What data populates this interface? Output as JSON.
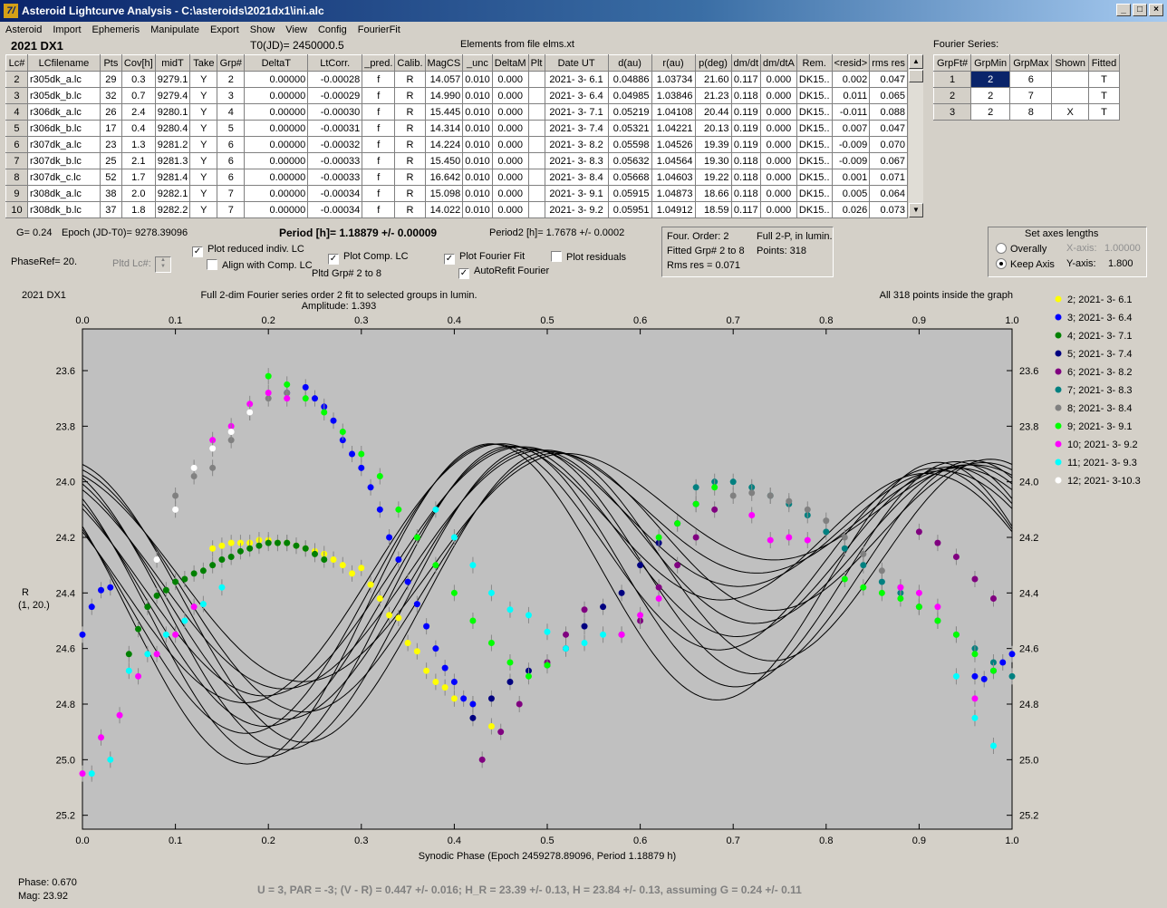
{
  "window": {
    "title": "Asteroid Lightcurve Analysis - C:\\asteroids\\2021dx1\\ini.alc",
    "icon_glyph": "7/"
  },
  "menu": [
    "Asteroid",
    "Import",
    "Ephemeris",
    "Manipulate",
    "Export",
    "Show",
    "View",
    "Config",
    "FourierFit"
  ],
  "header": {
    "object": "2021 DX1",
    "t0": "T0(JD)= 2450000.5",
    "elements": "Elements from file elms.xt"
  },
  "lc_table": {
    "columns": [
      "Lc#",
      "LCfilename",
      "Pts",
      "Cov[h]",
      "midT",
      "Take",
      "Grp#",
      "DeltaT",
      "LtCorr.",
      "_pred.",
      "Calib.",
      "MagCS",
      "_unc",
      "DeltaM",
      "Plt",
      "Date UT",
      "d(au)",
      "r(au)",
      "p(deg)",
      "dm/dt",
      "dm/dtA",
      "Rem.",
      "<resid>",
      "rms res"
    ],
    "rows": [
      [
        "2",
        "r305dk_a.lc",
        "29",
        "0.3",
        "9279.1",
        "Y",
        "2",
        "0.00000",
        "-0.00028",
        "f",
        "R",
        "14.057",
        "0.010",
        "0.000",
        "",
        "2021- 3- 6.1",
        "0.04886",
        "1.03734",
        "21.60",
        "0.117",
        "0.000",
        "DK15..",
        "0.002",
        "0.047"
      ],
      [
        "3",
        "r305dk_b.lc",
        "32",
        "0.7",
        "9279.4",
        "Y",
        "3",
        "0.00000",
        "-0.00029",
        "f",
        "R",
        "14.990",
        "0.010",
        "0.000",
        "",
        "2021- 3- 6.4",
        "0.04985",
        "1.03846",
        "21.23",
        "0.118",
        "0.000",
        "DK15..",
        "0.011",
        "0.065"
      ],
      [
        "4",
        "r306dk_a.lc",
        "26",
        "2.4",
        "9280.1",
        "Y",
        "4",
        "0.00000",
        "-0.00030",
        "f",
        "R",
        "15.445",
        "0.010",
        "0.000",
        "",
        "2021- 3- 7.1",
        "0.05219",
        "1.04108",
        "20.44",
        "0.119",
        "0.000",
        "DK15..",
        "-0.011",
        "0.088"
      ],
      [
        "5",
        "r306dk_b.lc",
        "17",
        "0.4",
        "9280.4",
        "Y",
        "5",
        "0.00000",
        "-0.00031",
        "f",
        "R",
        "14.314",
        "0.010",
        "0.000",
        "",
        "2021- 3- 7.4",
        "0.05321",
        "1.04221",
        "20.13",
        "0.119",
        "0.000",
        "DK15..",
        "0.007",
        "0.047"
      ],
      [
        "6",
        "r307dk_a.lc",
        "23",
        "1.3",
        "9281.2",
        "Y",
        "6",
        "0.00000",
        "-0.00032",
        "f",
        "R",
        "14.224",
        "0.010",
        "0.000",
        "",
        "2021- 3- 8.2",
        "0.05598",
        "1.04526",
        "19.39",
        "0.119",
        "0.000",
        "DK15..",
        "-0.009",
        "0.070"
      ],
      [
        "7",
        "r307dk_b.lc",
        "25",
        "2.1",
        "9281.3",
        "Y",
        "6",
        "0.00000",
        "-0.00033",
        "f",
        "R",
        "15.450",
        "0.010",
        "0.000",
        "",
        "2021- 3- 8.3",
        "0.05632",
        "1.04564",
        "19.30",
        "0.118",
        "0.000",
        "DK15..",
        "-0.009",
        "0.067"
      ],
      [
        "8",
        "r307dk_c.lc",
        "52",
        "1.7",
        "9281.4",
        "Y",
        "6",
        "0.00000",
        "-0.00033",
        "f",
        "R",
        "16.642",
        "0.010",
        "0.000",
        "",
        "2021- 3- 8.4",
        "0.05668",
        "1.04603",
        "19.22",
        "0.118",
        "0.000",
        "DK15..",
        "0.001",
        "0.071"
      ],
      [
        "9",
        "r308dk_a.lc",
        "38",
        "2.0",
        "9282.1",
        "Y",
        "7",
        "0.00000",
        "-0.00034",
        "f",
        "R",
        "15.098",
        "0.010",
        "0.000",
        "",
        "2021- 3- 9.1",
        "0.05915",
        "1.04873",
        "18.66",
        "0.118",
        "0.000",
        "DK15..",
        "0.005",
        "0.064"
      ],
      [
        "10",
        "r308dk_b.lc",
        "37",
        "1.8",
        "9282.2",
        "Y",
        "7",
        "0.00000",
        "-0.00034",
        "f",
        "R",
        "14.022",
        "0.010",
        "0.000",
        "",
        "2021- 3- 9.2",
        "0.05951",
        "1.04912",
        "18.59",
        "0.117",
        "0.000",
        "DK15..",
        "0.026",
        "0.073"
      ]
    ]
  },
  "fourier_series": {
    "title": "Fourier Series:",
    "columns": [
      "GrpFt#",
      "GrpMin",
      "GrpMax",
      "Shown",
      "Fitted"
    ],
    "rows": [
      [
        "1",
        "2",
        "6",
        "",
        "T"
      ],
      [
        "2",
        "2",
        "7",
        "",
        "T"
      ],
      [
        "3",
        "2",
        "8",
        "X",
        "T"
      ]
    ]
  },
  "info": {
    "g": "G= 0.24",
    "epoch": "Epoch (JD-T0)= 9278.39096",
    "period": "Period [h]= 1.18879 +/- 0.00009",
    "period2": "Period2 [h]= 1.7678 +/- 0.0002",
    "phaseref": "PhaseRef= 20.",
    "pltd_lc": "Pltd Lc#:",
    "plot_reduced": "Plot reduced indiv. LC",
    "align": "Align with Comp. LC",
    "plot_comp": "Plot Comp. LC",
    "pltd_grp": "Pltd Grp#  2   to   8",
    "plot_fourier": "Plot Fourier Fit",
    "autorefit": "AutoRefit Fourier",
    "plot_residuals": "Plot residuals"
  },
  "fit_summary": {
    "four_order": "Four. Order:  2",
    "full2p": "Full 2-P, in lumin.",
    "fitted_grp": "Fitted Grp# 2 to 8",
    "points": "Points: 318",
    "rms": "Rms res     = 0.071"
  },
  "axes_panel": {
    "title": "Set axes lengths",
    "overally": "Overally",
    "keep_axis": "Keep Axis",
    "x_axis_label": "X-axis:",
    "x_axis_value": "1.00000",
    "y_axis_label": "Y-axis:",
    "y_axis_value": "1.800"
  },
  "chart_data": {
    "type": "scatter",
    "title": "Full 2-dim Fourier series order 2 fit to selected groups in lumin.",
    "subtitle": "Amplitude: 1.393",
    "object_label": "2021 DX1",
    "top_right_note": "All 318 points inside the graph",
    "xlabel": "Synodic Phase (Epoch 2459278.89096, Period 1.18879 h)",
    "ylabel": "R",
    "ylabel2": "(1, 20.)",
    "xlim": [
      0,
      1
    ],
    "ylim": [
      25.25,
      23.45
    ],
    "y_inverted": true,
    "grid": false,
    "legend_position": "right",
    "x_ticks": [
      "0.0",
      "0.1",
      "0.2",
      "0.3",
      "0.4",
      "0.5",
      "0.6",
      "0.7",
      "0.8",
      "0.9",
      "1.0"
    ],
    "y_ticks": [
      "23.6",
      "23.8",
      "24.0",
      "24.2",
      "24.4",
      "24.6",
      "24.8",
      "25.0",
      "25.2"
    ],
    "series": [
      {
        "name": "2; 2021- 3- 6.1",
        "color": "#ffff00",
        "x": [
          0.14,
          0.15,
          0.16,
          0.17,
          0.18,
          0.19,
          0.2,
          0.21,
          0.22,
          0.23,
          0.24,
          0.25,
          0.26,
          0.27,
          0.28,
          0.29,
          0.3,
          0.31,
          0.32,
          0.33,
          0.34,
          0.35,
          0.36,
          0.37,
          0.38,
          0.39,
          0.4,
          0.42,
          0.44
        ],
        "y": [
          24.24,
          24.23,
          24.22,
          24.22,
          24.22,
          24.21,
          24.21,
          24.22,
          24.22,
          24.23,
          24.24,
          24.25,
          24.26,
          24.28,
          24.3,
          24.33,
          24.31,
          24.37,
          24.42,
          24.48,
          24.49,
          24.58,
          24.61,
          24.68,
          24.72,
          24.74,
          24.78,
          24.8,
          24.88
        ]
      },
      {
        "name": "3; 2021- 3- 6.4",
        "color": "#0000ff",
        "x": [
          0.0,
          0.01,
          0.02,
          0.03,
          0.22,
          0.24,
          0.25,
          0.26,
          0.27,
          0.28,
          0.29,
          0.3,
          0.31,
          0.32,
          0.33,
          0.34,
          0.35,
          0.36,
          0.37,
          0.38,
          0.39,
          0.4,
          0.41,
          0.42,
          0.96,
          0.97,
          0.98,
          0.99,
          1.0
        ],
        "y": [
          24.55,
          24.45,
          24.39,
          24.38,
          23.68,
          23.66,
          23.7,
          23.73,
          23.78,
          23.85,
          23.9,
          23.95,
          24.02,
          24.1,
          24.2,
          24.28,
          24.36,
          24.44,
          24.52,
          24.6,
          24.67,
          24.72,
          24.78,
          24.8,
          24.7,
          24.71,
          24.68,
          24.65,
          24.62
        ]
      },
      {
        "name": "4; 2021- 3- 7.1",
        "color": "#008000",
        "x": [
          0.05,
          0.06,
          0.07,
          0.08,
          0.09,
          0.1,
          0.11,
          0.12,
          0.13,
          0.14,
          0.15,
          0.16,
          0.17,
          0.18,
          0.19,
          0.2,
          0.21,
          0.22,
          0.23,
          0.24,
          0.25,
          0.26
        ],
        "y": [
          24.62,
          24.53,
          24.45,
          24.41,
          24.39,
          24.36,
          24.35,
          24.33,
          24.32,
          24.3,
          24.28,
          24.27,
          24.25,
          24.24,
          24.23,
          24.22,
          24.22,
          24.22,
          24.23,
          24.24,
          24.26,
          24.28
        ]
      },
      {
        "name": "5; 2021- 3- 7.4",
        "color": "#000080",
        "x": [
          0.42,
          0.44,
          0.46,
          0.48,
          0.5,
          0.52,
          0.54,
          0.56,
          0.58,
          0.6,
          0.62,
          0.64,
          0.66
        ],
        "y": [
          24.85,
          24.78,
          24.72,
          24.68,
          24.66,
          24.6,
          24.52,
          24.45,
          24.4,
          24.3,
          24.22,
          24.15,
          24.08
        ]
      },
      {
        "name": "6; 2021- 3- 8.2",
        "color": "#800080",
        "x": [
          0.43,
          0.45,
          0.47,
          0.5,
          0.52,
          0.54,
          0.58,
          0.6,
          0.62,
          0.64,
          0.66,
          0.68,
          0.9,
          0.92,
          0.94,
          0.96,
          0.98
        ],
        "y": [
          25.0,
          24.9,
          24.8,
          24.65,
          24.55,
          24.46,
          24.55,
          24.5,
          24.38,
          24.3,
          24.2,
          24.1,
          24.18,
          24.22,
          24.27,
          24.35,
          24.42
        ]
      },
      {
        "name": "7; 2021- 3- 8.3",
        "color": "#008080",
        "x": [
          0.66,
          0.68,
          0.7,
          0.72,
          0.74,
          0.76,
          0.78,
          0.8,
          0.82,
          0.84,
          0.86,
          0.88,
          0.9,
          0.92,
          0.94,
          0.96,
          0.98,
          1.0
        ],
        "y": [
          24.02,
          24.0,
          24.0,
          24.02,
          24.05,
          24.08,
          24.12,
          24.18,
          24.24,
          24.3,
          24.36,
          24.4,
          24.45,
          24.5,
          24.55,
          24.6,
          24.65,
          24.7
        ]
      },
      {
        "name": "8; 2021- 3- 8.4",
        "color": "#808080",
        "x": [
          0.1,
          0.12,
          0.14,
          0.16,
          0.18,
          0.2,
          0.22,
          0.7,
          0.72,
          0.74,
          0.76,
          0.78,
          0.8,
          0.82,
          0.84,
          0.86,
          0.88,
          0.9
        ],
        "y": [
          24.05,
          23.98,
          23.95,
          23.85,
          23.75,
          23.7,
          23.68,
          24.05,
          24.04,
          24.05,
          24.07,
          24.1,
          24.14,
          24.2,
          24.26,
          24.32,
          24.38,
          24.45
        ]
      },
      {
        "name": "9; 2021- 3- 9.1",
        "color": "#00ff00",
        "x": [
          0.2,
          0.22,
          0.24,
          0.26,
          0.28,
          0.3,
          0.32,
          0.34,
          0.36,
          0.38,
          0.4,
          0.42,
          0.44,
          0.46,
          0.48,
          0.5,
          0.62,
          0.64,
          0.66,
          0.68,
          0.82,
          0.84,
          0.86,
          0.88,
          0.9,
          0.92,
          0.94,
          0.96,
          0.98
        ],
        "y": [
          23.62,
          23.65,
          23.7,
          23.75,
          23.82,
          23.9,
          23.98,
          24.1,
          24.2,
          24.3,
          24.4,
          24.5,
          24.58,
          24.65,
          24.7,
          24.66,
          24.2,
          24.15,
          24.08,
          24.02,
          24.35,
          24.38,
          24.4,
          24.42,
          24.45,
          24.5,
          24.55,
          24.62,
          24.68
        ]
      },
      {
        "name": "10; 2021- 3- 9.2",
        "color": "#ff00ff",
        "x": [
          0.0,
          0.02,
          0.04,
          0.06,
          0.08,
          0.1,
          0.12,
          0.14,
          0.16,
          0.18,
          0.2,
          0.22,
          0.58,
          0.6,
          0.62,
          0.72,
          0.74,
          0.76,
          0.78,
          0.88,
          0.9,
          0.92,
          0.96
        ],
        "y": [
          25.05,
          24.92,
          24.84,
          24.7,
          24.62,
          24.55,
          24.45,
          23.85,
          23.8,
          23.72,
          23.68,
          23.7,
          24.55,
          24.48,
          24.42,
          24.12,
          24.21,
          24.2,
          24.21,
          24.38,
          24.4,
          24.45,
          24.78
        ]
      },
      {
        "name": "11; 2021- 3- 9.3",
        "color": "#00ffff",
        "x": [
          0.01,
          0.03,
          0.05,
          0.07,
          0.09,
          0.11,
          0.13,
          0.15,
          0.38,
          0.4,
          0.42,
          0.44,
          0.46,
          0.48,
          0.5,
          0.52,
          0.54,
          0.56,
          0.94,
          0.96,
          0.98
        ],
        "y": [
          25.05,
          25.0,
          24.68,
          24.62,
          24.55,
          24.5,
          24.44,
          24.38,
          24.1,
          24.2,
          24.3,
          24.4,
          24.46,
          24.48,
          24.54,
          24.6,
          24.58,
          24.55,
          24.7,
          24.85,
          24.95
        ]
      },
      {
        "name": "12; 2021- 3-10.3",
        "color": "#ffffff",
        "x": [
          0.08,
          0.1,
          0.12,
          0.14,
          0.16,
          0.18
        ],
        "y": [
          24.28,
          24.1,
          23.95,
          23.88,
          23.82,
          23.75
        ]
      }
    ],
    "fit_curves_count": 12
  },
  "status": {
    "phase": "Phase:  0.670",
    "mag": "Mag:    23.92",
    "result": "U = 3, PAR = -3; (V - R) = 0.447 +/- 0.016; H_R = 23.39 +/- 0.13, H = 23.84 +/- 0.13, assuming G = 0.24 +/- 0.11"
  }
}
